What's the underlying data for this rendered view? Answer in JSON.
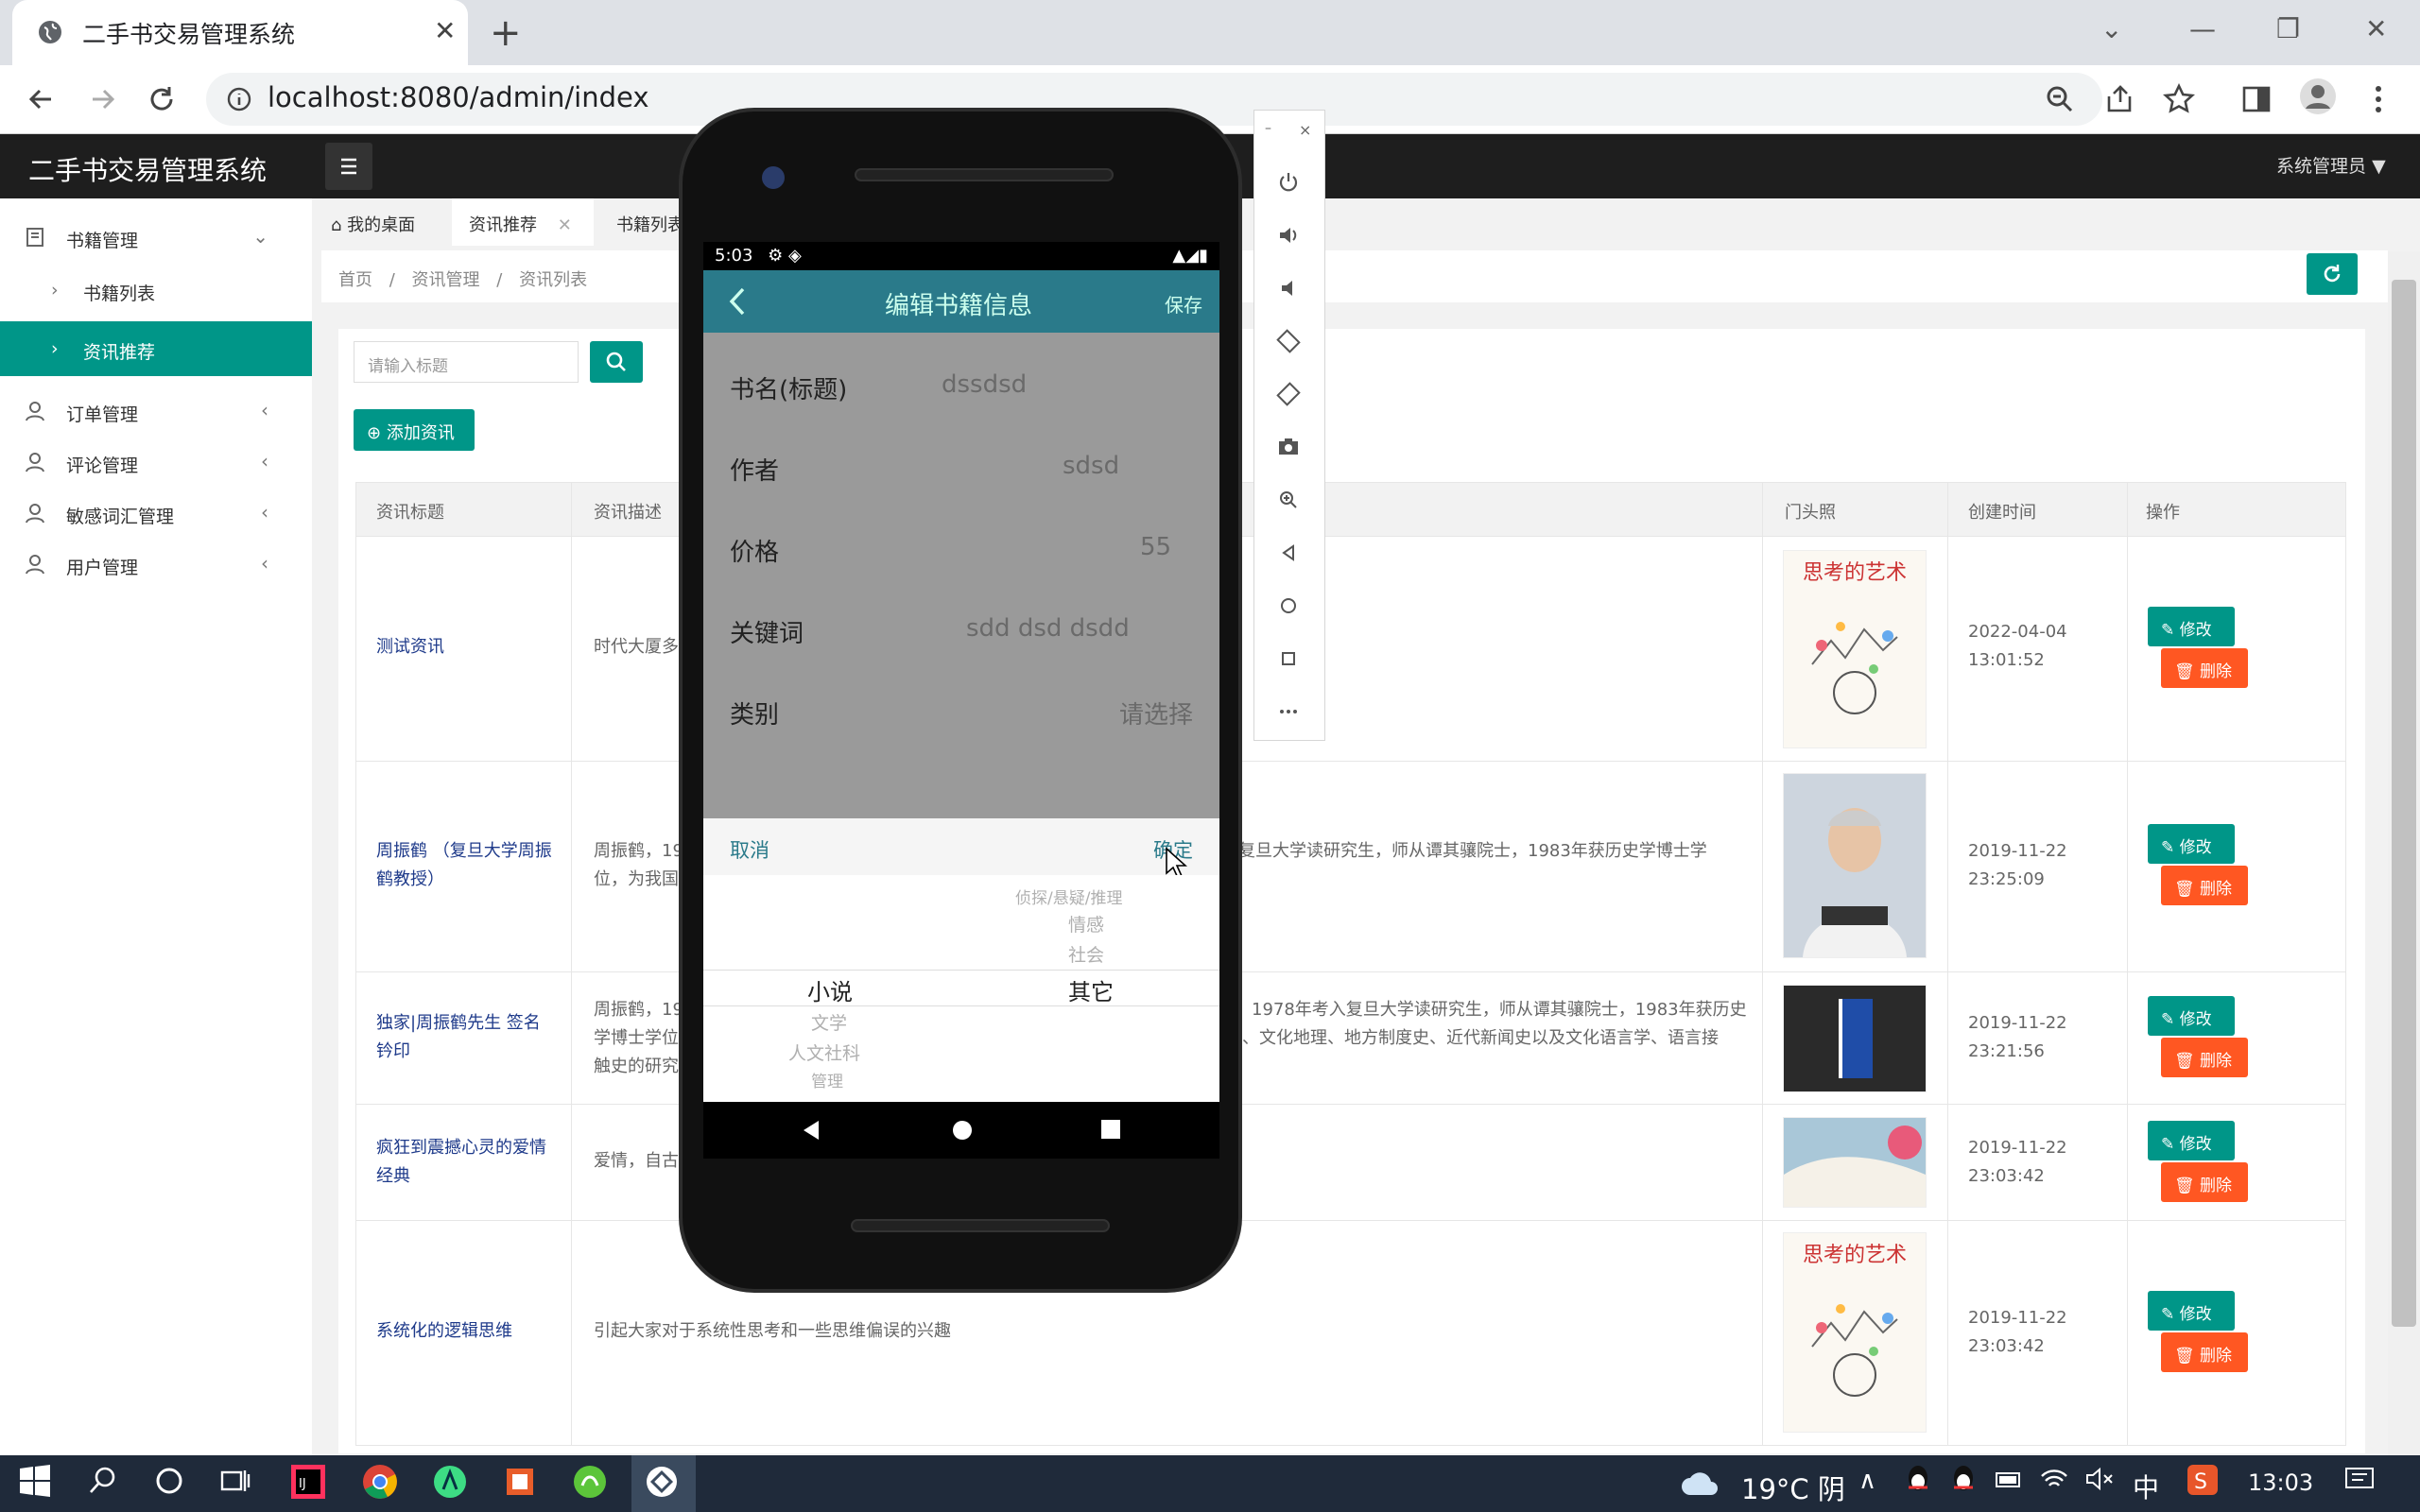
{
  "browser": {
    "tab_title": "二手书交易管理系统",
    "url": "localhost:8080/admin/index"
  },
  "app": {
    "title": "二手书交易管理系统",
    "admin_name": "系统管理员"
  },
  "sidebar": {
    "items": [
      {
        "label": "书籍管理",
        "icon": "book-icon"
      },
      {
        "label": "书籍列表"
      },
      {
        "label": "资讯推荐"
      },
      {
        "label": "订单管理",
        "icon": "user-icon"
      },
      {
        "label": "评论管理",
        "icon": "user-icon"
      },
      {
        "label": "敏感词汇管理",
        "icon": "user-icon"
      },
      {
        "label": "用户管理",
        "icon": "user-icon"
      }
    ]
  },
  "page_tabs": [
    {
      "label": "我的桌面"
    },
    {
      "label": "资讯推荐"
    },
    {
      "label": "书籍列表"
    }
  ],
  "breadcrumb": {
    "home": "首页",
    "sep": "/",
    "section": "资讯管理",
    "current": "资讯列表"
  },
  "search": {
    "placeholder": "请输入标题"
  },
  "add_button": "添加资讯",
  "table": {
    "headers": {
      "title": "资讯标题",
      "desc": "资讯描述",
      "photo": "门头照",
      "created": "创建时间",
      "actions": "操作"
    },
    "edit_label": "修改",
    "delete_label": "删除",
    "rows": [
      {
        "title": "测试资讯",
        "desc": "时代大厦多",
        "created": "2022-04-04 13:01:52"
      },
      {
        "title": "周振鹤 （复旦大学周振鹤教授）",
        "desc": "周振鹤，19",
        "desc_right": "复旦大学读研究生，师从谭其骧院士，1983年获历史学博士学",
        "desc_right2": "位，为我国",
        "created": "2019-11-22 23:25:09"
      },
      {
        "title": "独家|周振鹤先生 签名钤印",
        "desc": "周振鹤，19",
        "desc_right": "1978年考入复旦大学读研究生，师从谭其骧院士，1983年获历史",
        "desc_line2": "学博士学位",
        "desc_right2": "、文化地理、地方制度史、近代新闻史以及文化语言学、语言接",
        "desc_line3": "触史的研究",
        "created": "2019-11-22 23:21:56"
      },
      {
        "title": "疯狂到震撼心灵的爱情经典",
        "desc": "爱情，自古",
        "created": "2019-11-22 23:03:42"
      },
      {
        "title": "系统化的逻辑思维",
        "desc": "引起大家对于系统性思考和一些思维偏误的兴趣",
        "created": "2019-11-22 23:03:42"
      }
    ]
  },
  "phone": {
    "status_time": "5:03",
    "header_title": "编辑书籍信息",
    "save": "保存",
    "fields": [
      {
        "label": "书名(标题)",
        "value": "dssdsd"
      },
      {
        "label": "作者",
        "value": "sdsd"
      },
      {
        "label": "价格",
        "value": "55"
      },
      {
        "label": "关键词",
        "value": "sdd dsd dsdd"
      },
      {
        "label": "类别",
        "value": "请选择"
      }
    ],
    "picker": {
      "cancel": "取消",
      "confirm": "确定",
      "left_selected": "小说",
      "left_below": [
        "文学",
        "人文社科",
        "管理"
      ],
      "right_above": [
        "侦探/悬疑/推理",
        "情感",
        "社会"
      ],
      "right_selected": "其它"
    }
  },
  "taskbar": {
    "temperature": "19°C 阴",
    "ime": "中",
    "time": "13:03"
  }
}
